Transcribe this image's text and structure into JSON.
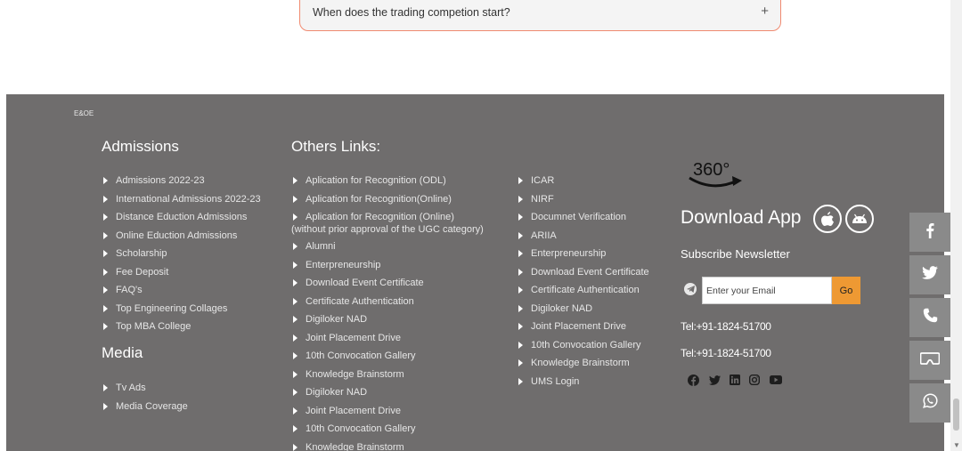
{
  "faq": {
    "question": "When does the trading competion start?",
    "toggle": "+"
  },
  "footer": {
    "eoe": "E&OE",
    "admissions": {
      "title": "Admissions",
      "items": [
        "Admissions 2022-23",
        "International Admissions 2022-23",
        "Distance Eduction Admissions",
        "Online Eduction Admissions",
        "Scholarship",
        "Fee Deposit",
        "FAQ's",
        "Top Engineering Collages",
        "Top MBA College"
      ]
    },
    "media": {
      "title": "Media",
      "items": [
        "Tv Ads",
        "Media Coverage"
      ]
    },
    "others": {
      "title": "Others Links:",
      "items": [
        "Aplication for Recognition (ODL)",
        "Aplication for Recognition(Online)",
        "Aplication for Recognition (Online)",
        "Alumni",
        "Enterpreneurship",
        "Download Event Certificate",
        "Certificate Authentication",
        "Digiloker NAD",
        "Joint Placement Drive",
        "10th Convocation Gallery",
        "Knowledge Brainstorm",
        "Digiloker NAD",
        "Joint Placement Drive",
        "10th Convocation Gallery",
        "Knowledge Brainstorm"
      ],
      "item3_sub": "(without prior approval of the UGC category)"
    },
    "others2": {
      "items": [
        "ICAR",
        "NIRF",
        "Documnet Verification",
        "ARIIA",
        "Enterpreneurship",
        "Download Event Certificate",
        "Certificate Authentication",
        "Digiloker NAD",
        "Joint Placement Drive",
        "10th Convocation Gallery",
        "Knowledge Brainstorm",
        "UMS Login"
      ]
    },
    "logo_text": "360°",
    "download_app": "Download App",
    "subscribe_title": "Subscribe Newsletter",
    "email_placeholder": "Enter your Email",
    "go_label": "Go",
    "tel1": "Tel:+91-1824-51700",
    "tel2": "Tel:+91-1824-51700",
    "social_icons": [
      "facebook-icon",
      "twitter-icon",
      "linkedin-icon",
      "instagram-icon",
      "youtube-icon"
    ]
  },
  "side_buttons": [
    "facebook-icon",
    "twitter-icon",
    "phone-icon",
    "vr-headset-icon",
    "whatsapp-icon"
  ],
  "colors": {
    "footer_bg": "#6f6d6d",
    "go_button": "#ee9933",
    "faq_border": "#f08a70",
    "side_button": "#8a8a8a"
  }
}
